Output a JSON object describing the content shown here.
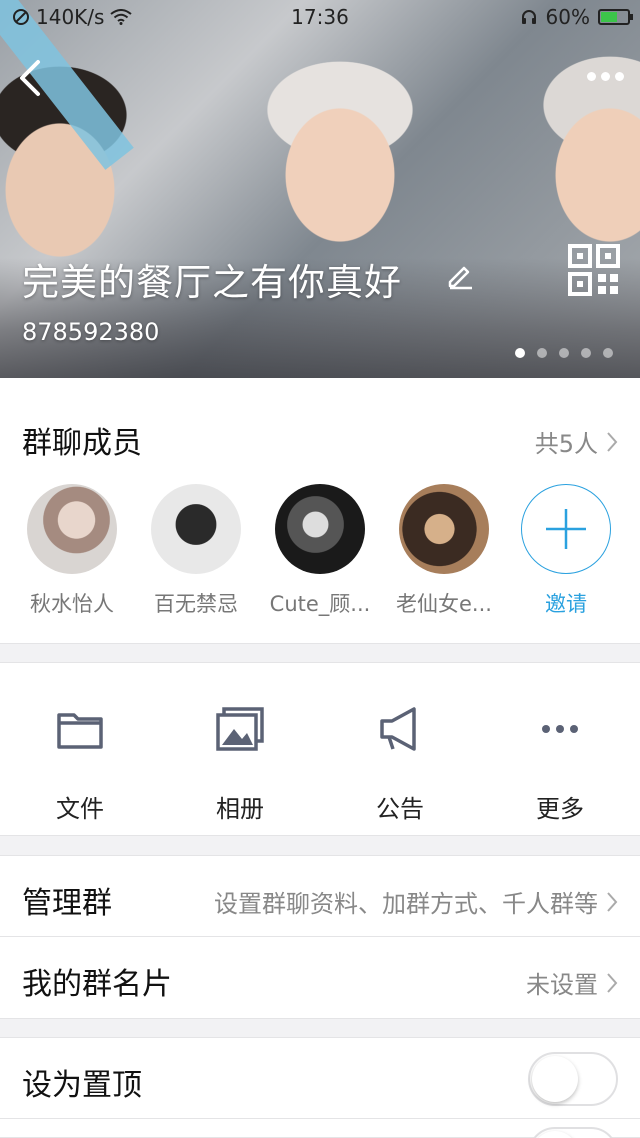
{
  "status_bar": {
    "speed": "140K/s",
    "time": "17:36",
    "battery": "60%",
    "battery_level": 0.6
  },
  "header": {
    "group_name": "完美的餐厅之有你真好",
    "group_id": "878592380",
    "page_indicator": {
      "total": 5,
      "active": 0
    }
  },
  "members": {
    "title": "群聊成员",
    "count_label": "共5人",
    "list": [
      {
        "name": "秋水怡人"
      },
      {
        "name": "百无禁忌"
      },
      {
        "name": "Cute_顾..."
      },
      {
        "name": "老仙女e..."
      }
    ],
    "invite_label": "邀请"
  },
  "shortcuts": [
    {
      "label": "文件",
      "icon": "folder-icon"
    },
    {
      "label": "相册",
      "icon": "album-icon"
    },
    {
      "label": "公告",
      "icon": "megaphone-icon"
    },
    {
      "label": "更多",
      "icon": "more-horizontal-icon"
    }
  ],
  "settings": {
    "manage_group": {
      "label": "管理群",
      "value": "设置群聊资料、加群方式、千人群等"
    },
    "my_card": {
      "label": "我的群名片",
      "value": "未设置"
    },
    "pin_top": {
      "label": "设为置顶",
      "enabled": false
    }
  },
  "colors": {
    "accent": "#2aa1df",
    "background": "#f2f2f4",
    "icon_gray": "#5b6275"
  }
}
